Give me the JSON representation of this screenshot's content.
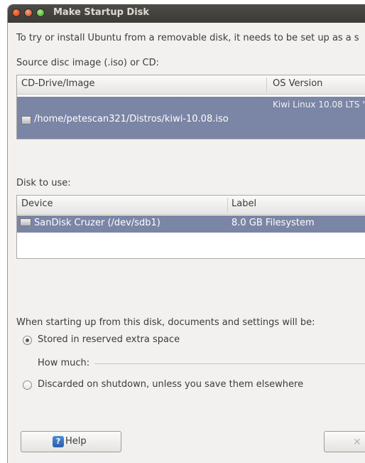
{
  "window": {
    "title": "Make Startup Disk"
  },
  "intro_text": "To try or install Ubuntu from a removable disk, it needs to be set up as a s",
  "source": {
    "label": "Source disc image (.iso) or CD:",
    "columns": [
      "CD-Drive/Image",
      "OS Version"
    ],
    "rows": [
      {
        "image": "/home/petescan321/Distros/kiwi-10.08.iso",
        "os_version": "Kiwi Linux 10.08 LTS \""
      }
    ]
  },
  "disk": {
    "label": "Disk to use:",
    "columns": [
      "Device",
      "Label"
    ],
    "rows": [
      {
        "device": "SanDisk Cruzer (/dev/sdb1)",
        "label": "8.0 GB Filesystem"
      }
    ]
  },
  "persistence": {
    "heading": "When starting up from this disk, documents and settings will be:",
    "option_stored": "Stored in reserved extra space",
    "how_much": "How much:",
    "option_discarded": "Discarded on shutdown, unless you save them elsewhere",
    "selected": "stored"
  },
  "buttons": {
    "help": "Help",
    "help_icon": "?"
  },
  "colors": {
    "selection": "#7b86a6",
    "titlebar": "#3c3b37",
    "accent_blue": "#275ea8"
  }
}
